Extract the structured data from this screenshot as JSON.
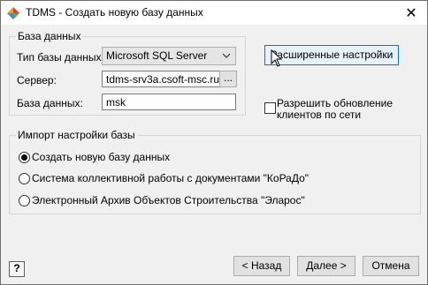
{
  "window": {
    "title": "TDMS - Создать новую базу данных",
    "close_glyph": "✕"
  },
  "database_group": {
    "legend": "База данных",
    "type_label": "Тип базы данных:",
    "type_value": "Microsoft SQL Server",
    "server_label": "Сервер:",
    "server_value": "tdms-srv3a.csoft-msc.ru",
    "browse_label": "...",
    "db_label": "База данных:",
    "db_value": "msk"
  },
  "advanced_button": "Расширенные настройки",
  "allow_update": {
    "label_line1": "Разрешить обновление",
    "label_line2": "клиентов по сети",
    "checked": false
  },
  "import_group": {
    "legend": "Импорт настройки базы",
    "options": [
      {
        "label": "Создать новую базу данных",
        "selected": true
      },
      {
        "label": "Система коллективной работы с документами \"КоРаДо\"",
        "selected": false
      },
      {
        "label": "Электронный Архив Объектов Строительства \"Эларос\"",
        "selected": false
      }
    ]
  },
  "footer": {
    "help_label": "?",
    "back_label": "< Назад",
    "next_label": "Далее >",
    "cancel_label": "Отмена"
  }
}
